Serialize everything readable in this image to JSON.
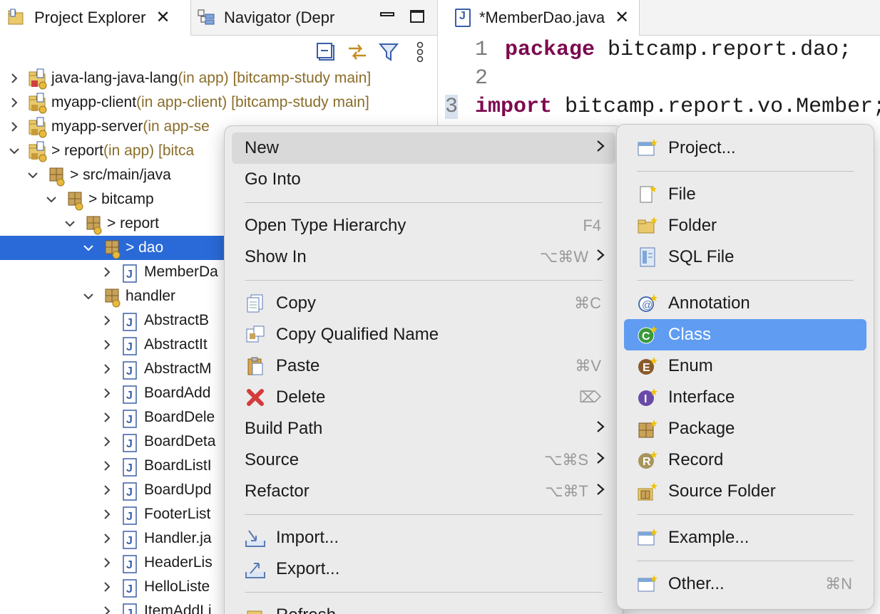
{
  "explorer": {
    "tab_project": "Project Explorer",
    "tab_navigator": "Navigator (Depr",
    "tree": [
      {
        "name": "java-lang-java-lang",
        "decor": " (in app) [bitcamp-study main]",
        "level": 0,
        "expanded": false
      },
      {
        "name": "myapp-client",
        "decor": " (in app-client) [bitcamp-study main]",
        "level": 0,
        "expanded": false
      },
      {
        "name": "myapp-server",
        "decor": " (in app-se",
        "level": 0,
        "expanded": false
      },
      {
        "name": "> report",
        "decor": " (in app) [bitca",
        "level": 0,
        "expanded": true
      },
      {
        "name": "> src/main/java",
        "decor": "",
        "level": 1,
        "expanded": true
      },
      {
        "name": "> bitcamp",
        "decor": "",
        "level": 2,
        "expanded": true
      },
      {
        "name": "> report",
        "decor": "",
        "level": 3,
        "expanded": true
      },
      {
        "name": "> dao",
        "decor": "",
        "level": 4,
        "expanded": true,
        "selected": true
      },
      {
        "name": "MemberDa",
        "decor": "",
        "level": 5,
        "expanded": false
      },
      {
        "name": "handler",
        "decor": "",
        "level": 4,
        "expanded": true
      },
      {
        "name": "AbstractB",
        "decor": "",
        "level": 5,
        "expanded": false
      },
      {
        "name": "AbstractIt",
        "decor": "",
        "level": 5,
        "expanded": false
      },
      {
        "name": "AbstractM",
        "decor": "",
        "level": 5,
        "expanded": false
      },
      {
        "name": "BoardAdd",
        "decor": "",
        "level": 5,
        "expanded": false
      },
      {
        "name": "BoardDele",
        "decor": "",
        "level": 5,
        "expanded": false
      },
      {
        "name": "BoardDeta",
        "decor": "",
        "level": 5,
        "expanded": false
      },
      {
        "name": "BoardListI",
        "decor": "",
        "level": 5,
        "expanded": false
      },
      {
        "name": "BoardUpd",
        "decor": "",
        "level": 5,
        "expanded": false
      },
      {
        "name": "FooterList",
        "decor": "",
        "level": 5,
        "expanded": false
      },
      {
        "name": "Handler.ja",
        "decor": "",
        "level": 5,
        "expanded": false
      },
      {
        "name": "HeaderLis",
        "decor": "",
        "level": 5,
        "expanded": false
      },
      {
        "name": "HelloListe",
        "decor": "",
        "level": 5,
        "expanded": false
      },
      {
        "name": "ItemAddLi",
        "decor": "",
        "level": 5,
        "expanded": false
      }
    ]
  },
  "editor": {
    "tab_title": "*MemberDao.java",
    "lines": [
      {
        "num": "1",
        "keyword": "package",
        "rest": " bitcamp.report.dao;"
      },
      {
        "num": "2",
        "keyword": "",
        "rest": ""
      },
      {
        "num": "3",
        "keyword": "import",
        "rest": " bitcamp.report.vo.Member;"
      }
    ]
  },
  "context_menu": {
    "items": [
      {
        "label": "New",
        "submenu": true,
        "highlight": true
      },
      {
        "label": "Go Into"
      },
      {
        "separator": true
      },
      {
        "label": "Open Type Hierarchy",
        "shortcut": "F4"
      },
      {
        "label": "Show In",
        "shortcut": "⌥⌘W",
        "submenu": true
      },
      {
        "separator": true
      },
      {
        "label": "Copy",
        "shortcut": "⌘C",
        "icon": "copy-icon"
      },
      {
        "label": "Copy Qualified Name",
        "icon": "copy-qualified-icon"
      },
      {
        "label": "Paste",
        "shortcut": "⌘V",
        "icon": "paste-icon"
      },
      {
        "label": "Delete",
        "shortcut": "⌦",
        "icon": "delete-icon"
      },
      {
        "label": "Build Path",
        "submenu": true
      },
      {
        "label": "Source",
        "shortcut": "⌥⌘S",
        "submenu": true
      },
      {
        "label": "Refactor",
        "shortcut": "⌥⌘T",
        "submenu": true
      },
      {
        "separator": true
      },
      {
        "label": "Import...",
        "icon": "import-icon"
      },
      {
        "label": "Export...",
        "icon": "export-icon"
      },
      {
        "separator": true
      },
      {
        "label": "Refresh",
        "icon": "refresh-icon"
      }
    ]
  },
  "new_submenu": {
    "items": [
      {
        "label": "Project...",
        "icon": "new-project-icon"
      },
      {
        "separator": true
      },
      {
        "label": "File",
        "icon": "new-file-icon"
      },
      {
        "label": "Folder",
        "icon": "new-folder-icon"
      },
      {
        "label": "SQL File",
        "icon": "sql-file-icon"
      },
      {
        "separator": true
      },
      {
        "label": "Annotation",
        "icon": "annotation-icon"
      },
      {
        "label": "Class",
        "icon": "class-icon",
        "highlight": true
      },
      {
        "label": "Enum",
        "icon": "enum-icon"
      },
      {
        "label": "Interface",
        "icon": "interface-icon"
      },
      {
        "label": "Package",
        "icon": "package-icon"
      },
      {
        "label": "Record",
        "icon": "record-icon"
      },
      {
        "label": "Source Folder",
        "icon": "source-folder-icon"
      },
      {
        "separator": true
      },
      {
        "label": "Example...",
        "icon": "example-icon"
      },
      {
        "separator": true
      },
      {
        "label": "Other...",
        "shortcut": "⌘N",
        "icon": "other-icon"
      }
    ]
  },
  "colors": {
    "selection": "#2a6ad8",
    "menu_highlight": "#5f9cf2",
    "keyword": "#7d0a4f",
    "decorator": "#8a6d2a"
  }
}
